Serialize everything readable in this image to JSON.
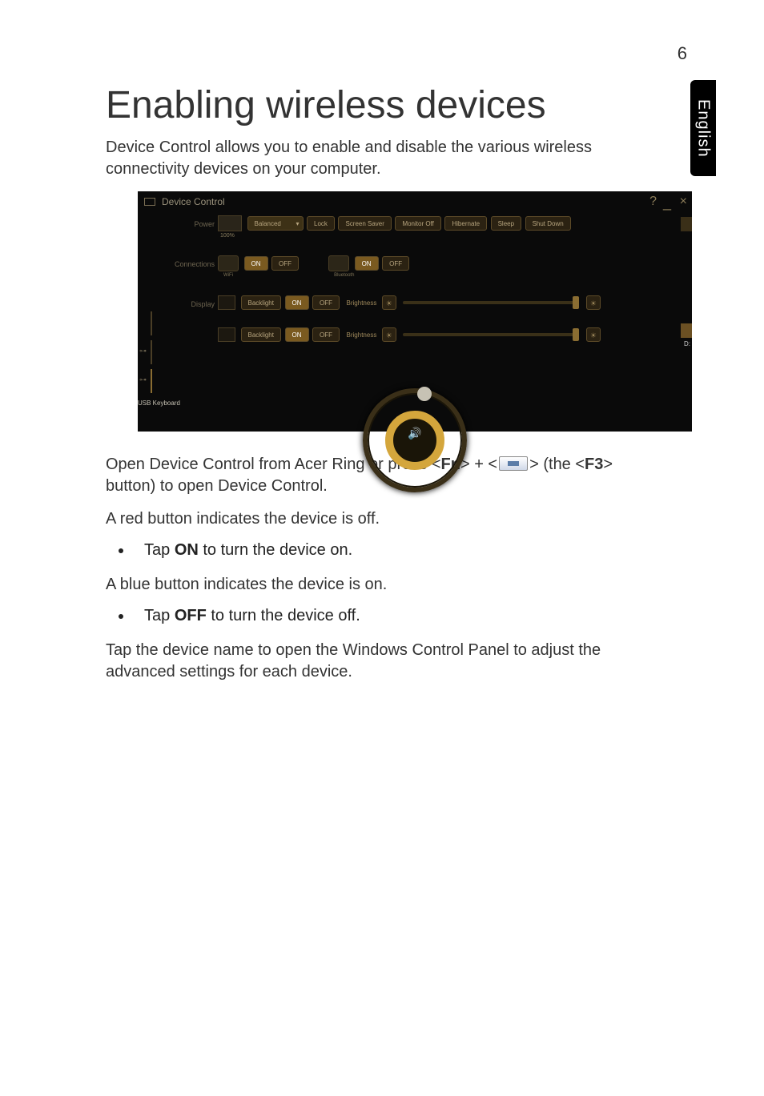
{
  "page_number": "6",
  "side_tab": "English",
  "heading": "Enabling wireless devices",
  "intro": "Device Control allows you to enable and disable the various wireless connectivity devices on your computer.",
  "screenshot": {
    "window_title": "Device Control",
    "rows": {
      "power": {
        "label": "Power",
        "battery_pct": "100%",
        "plan": "Balanced",
        "buttons": [
          "Lock",
          "Screen Saver",
          "Monitor Off",
          "Hibernate",
          "Sleep",
          "Shut Down"
        ]
      },
      "connections": {
        "label": "Connections",
        "wifi_label": "WiFi",
        "bt_label": "Bluetooth",
        "on": "ON",
        "off": "OFF"
      },
      "display": {
        "label": "Display",
        "backlight": "Backlight",
        "brightness": "Brightness",
        "on": "ON",
        "off": "OFF"
      }
    },
    "left_items": {
      "usb_keyboard": "USB Keyboard"
    },
    "right_drive": "D:"
  },
  "para_open_prefix": "Open Device Control from Acer Ring or press <",
  "para_open_fn": "Fn",
  "para_open_mid1": "> + <",
  "para_open_mid2": "> (the <",
  "para_open_f3": "F3",
  "para_open_suffix": "> button) to open Device Control.",
  "para_red": "A red button indicates the device is off.",
  "bullet_on_prefix": "Tap ",
  "bullet_on_bold": "ON",
  "bullet_on_suffix": " to turn the device on.",
  "para_blue": "A blue button indicates the device is on.",
  "bullet_off_prefix": "Tap ",
  "bullet_off_bold": "OFF",
  "bullet_off_suffix": " to turn the device off.",
  "para_tap_name": "Tap the device name to open the Windows Control Panel to adjust the advanced settings for each device."
}
